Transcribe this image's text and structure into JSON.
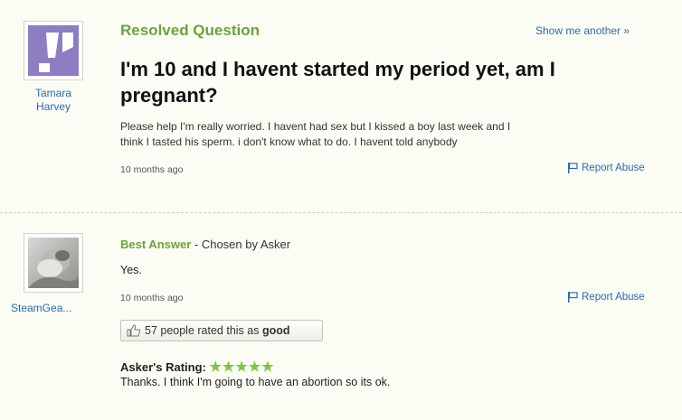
{
  "question": {
    "status": "Resolved Question",
    "show_another": "Show me another »",
    "asker": {
      "name_line1": "Tamara",
      "name_line2": "Harvey"
    },
    "title_line1": "I'm 10 and I havent started my period yet, am I",
    "title_line2": "pregnant?",
    "body_line1": "Please help I'm really worried. I havent had sex but I kissed a boy last week and I",
    "body_line2": "think I tasted his sperm. i don't know what to do. I havent told anybody",
    "time": "10 months ago",
    "report_abuse": "Report Abuse"
  },
  "answer": {
    "answerer": {
      "name": "SteamGea..."
    },
    "label": "Best Answer",
    "chosen_by": " - Chosen by Asker",
    "text": "Yes.",
    "time": "10 months ago",
    "report_abuse": "Report Abuse",
    "rating": {
      "count": "57",
      "text_prefix": " people rated this as ",
      "text_bold": "good"
    },
    "askers_rating_label": "Asker's Rating:",
    "askers_rating_stars": 5,
    "askers_rating_stars_text": "★★★★★",
    "asker_comment": "Thanks. I think I'm going to have an abortion so its ok."
  },
  "colors": {
    "accent_green": "#6aa43a",
    "link_blue": "#2e67b3",
    "default_avatar_purple": "#8d7ec4",
    "background": "#fbfdf5"
  },
  "icons": [
    "default-avatar-icon",
    "flag-icon",
    "thumbs-up-icon",
    "star-icon"
  ]
}
